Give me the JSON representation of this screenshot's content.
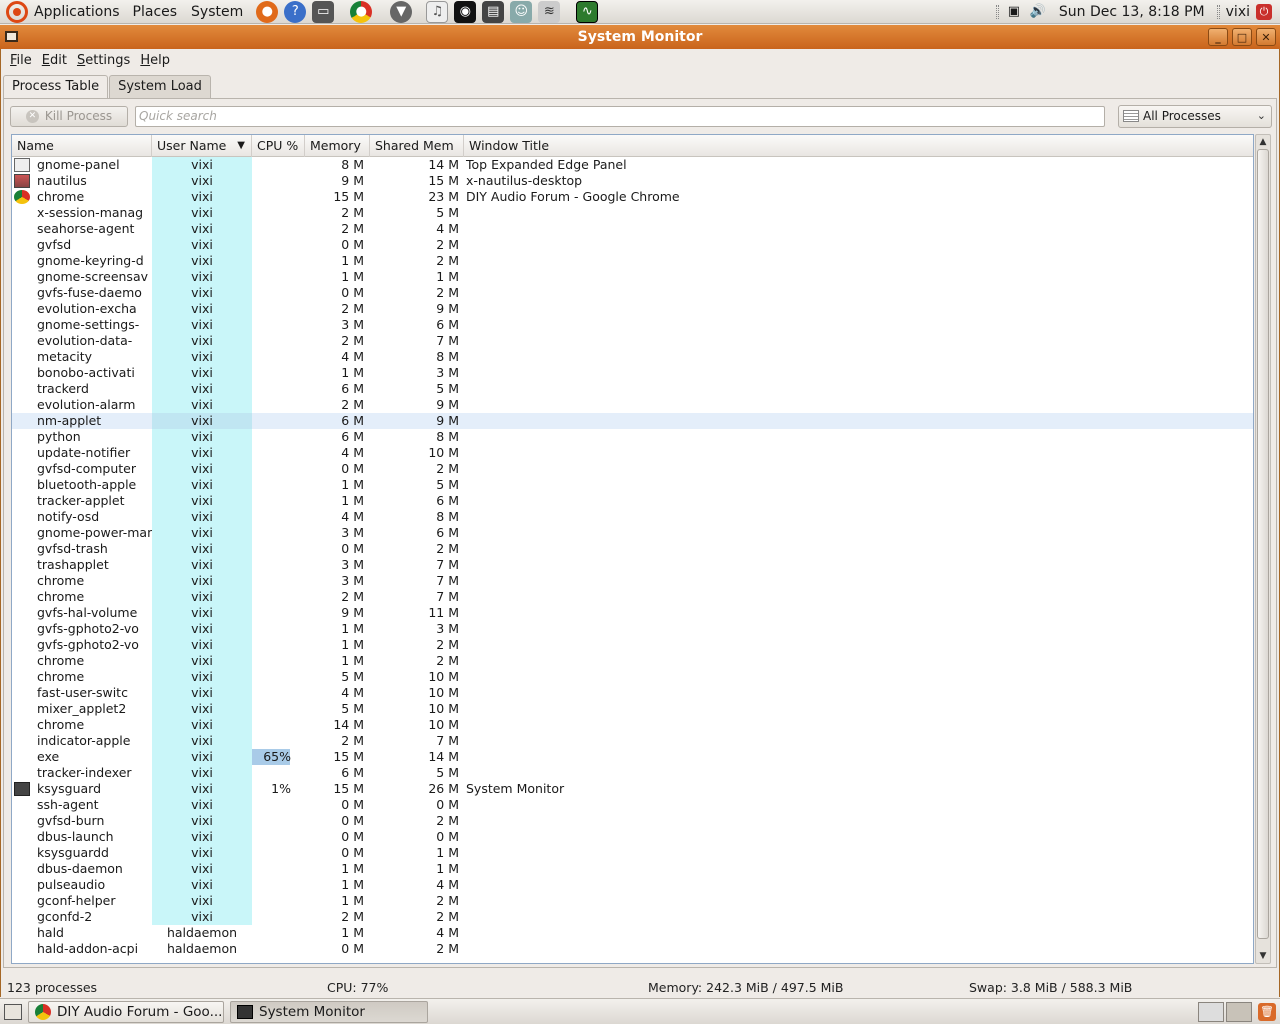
{
  "top_panel": {
    "menus": [
      "Applications",
      "Places",
      "System"
    ],
    "clock": "Sun Dec 13,  8:18 PM",
    "user": "vixi"
  },
  "window": {
    "title": "System Monitor",
    "menus": [
      "File",
      "Edit",
      "Settings",
      "Help"
    ],
    "tabs": [
      "Process Table",
      "System Load"
    ]
  },
  "toolbar": {
    "kill_label": "Kill Process",
    "search_placeholder": "Quick search",
    "filter_value": "All Processes"
  },
  "table": {
    "columns": [
      "Name",
      "User Name",
      "CPU %",
      "Memory",
      "Shared Mem",
      "Window Title"
    ],
    "rows": [
      {
        "name": "gnome-panel",
        "user": "vixi",
        "cpu": "",
        "mem": "8 M",
        "shared": "14 M",
        "title": "Top Expanded Edge Panel",
        "icon": "panel-icon"
      },
      {
        "name": "nautilus",
        "user": "vixi",
        "cpu": "",
        "mem": "9 M",
        "shared": "15 M",
        "title": "x-nautilus-desktop",
        "icon": "desktop-icon"
      },
      {
        "name": "chrome",
        "user": "vixi",
        "cpu": "",
        "mem": "15 M",
        "shared": "23 M",
        "title": "DIY Audio Forum - Google Chrome",
        "icon": "chrome-icon"
      },
      {
        "name": "x-session-manag",
        "user": "vixi",
        "cpu": "",
        "mem": "2 M",
        "shared": "5 M",
        "title": ""
      },
      {
        "name": "seahorse-agent",
        "user": "vixi",
        "cpu": "",
        "mem": "2 M",
        "shared": "4 M",
        "title": ""
      },
      {
        "name": "gvfsd",
        "user": "vixi",
        "cpu": "",
        "mem": "0 M",
        "shared": "2 M",
        "title": ""
      },
      {
        "name": "gnome-keyring-d",
        "user": "vixi",
        "cpu": "",
        "mem": "1 M",
        "shared": "2 M",
        "title": ""
      },
      {
        "name": "gnome-screensav",
        "user": "vixi",
        "cpu": "",
        "mem": "1 M",
        "shared": "1 M",
        "title": ""
      },
      {
        "name": "gvfs-fuse-daemo",
        "user": "vixi",
        "cpu": "",
        "mem": "0 M",
        "shared": "2 M",
        "title": ""
      },
      {
        "name": "evolution-excha",
        "user": "vixi",
        "cpu": "",
        "mem": "2 M",
        "shared": "9 M",
        "title": ""
      },
      {
        "name": "gnome-settings-",
        "user": "vixi",
        "cpu": "",
        "mem": "3 M",
        "shared": "6 M",
        "title": ""
      },
      {
        "name": "evolution-data-",
        "user": "vixi",
        "cpu": "",
        "mem": "2 M",
        "shared": "7 M",
        "title": ""
      },
      {
        "name": "metacity",
        "user": "vixi",
        "cpu": "",
        "mem": "4 M",
        "shared": "8 M",
        "title": ""
      },
      {
        "name": "bonobo-activati",
        "user": "vixi",
        "cpu": "",
        "mem": "1 M",
        "shared": "3 M",
        "title": ""
      },
      {
        "name": "trackerd",
        "user": "vixi",
        "cpu": "",
        "mem": "6 M",
        "shared": "5 M",
        "title": ""
      },
      {
        "name": "evolution-alarm",
        "user": "vixi",
        "cpu": "",
        "mem": "2 M",
        "shared": "9 M",
        "title": ""
      },
      {
        "name": "nm-applet",
        "user": "vixi",
        "cpu": "",
        "mem": "6 M",
        "shared": "9 M",
        "title": "",
        "selected": true
      },
      {
        "name": "python",
        "user": "vixi",
        "cpu": "",
        "mem": "6 M",
        "shared": "8 M",
        "title": ""
      },
      {
        "name": "update-notifier",
        "user": "vixi",
        "cpu": "",
        "mem": "4 M",
        "shared": "10 M",
        "title": ""
      },
      {
        "name": "gvfsd-computer",
        "user": "vixi",
        "cpu": "",
        "mem": "0 M",
        "shared": "2 M",
        "title": ""
      },
      {
        "name": "bluetooth-apple",
        "user": "vixi",
        "cpu": "",
        "mem": "1 M",
        "shared": "5 M",
        "title": ""
      },
      {
        "name": "tracker-applet",
        "user": "vixi",
        "cpu": "",
        "mem": "1 M",
        "shared": "6 M",
        "title": ""
      },
      {
        "name": "notify-osd",
        "user": "vixi",
        "cpu": "",
        "mem": "4 M",
        "shared": "8 M",
        "title": ""
      },
      {
        "name": "gnome-power-man",
        "user": "vixi",
        "cpu": "",
        "mem": "3 M",
        "shared": "6 M",
        "title": ""
      },
      {
        "name": "gvfsd-trash",
        "user": "vixi",
        "cpu": "",
        "mem": "0 M",
        "shared": "2 M",
        "title": ""
      },
      {
        "name": "trashapplet",
        "user": "vixi",
        "cpu": "",
        "mem": "3 M",
        "shared": "7 M",
        "title": ""
      },
      {
        "name": "chrome",
        "user": "vixi",
        "cpu": "",
        "mem": "3 M",
        "shared": "7 M",
        "title": ""
      },
      {
        "name": "chrome",
        "user": "vixi",
        "cpu": "",
        "mem": "2 M",
        "shared": "7 M",
        "title": ""
      },
      {
        "name": "gvfs-hal-volume",
        "user": "vixi",
        "cpu": "",
        "mem": "9 M",
        "shared": "11 M",
        "title": ""
      },
      {
        "name": "gvfs-gphoto2-vo",
        "user": "vixi",
        "cpu": "",
        "mem": "1 M",
        "shared": "3 M",
        "title": ""
      },
      {
        "name": "gvfs-gphoto2-vo",
        "user": "vixi",
        "cpu": "",
        "mem": "1 M",
        "shared": "2 M",
        "title": ""
      },
      {
        "name": "chrome",
        "user": "vixi",
        "cpu": "",
        "mem": "1 M",
        "shared": "2 M",
        "title": ""
      },
      {
        "name": "chrome",
        "user": "vixi",
        "cpu": "",
        "mem": "5 M",
        "shared": "10 M",
        "title": ""
      },
      {
        "name": "fast-user-switc",
        "user": "vixi",
        "cpu": "",
        "mem": "4 M",
        "shared": "10 M",
        "title": ""
      },
      {
        "name": "mixer_applet2",
        "user": "vixi",
        "cpu": "",
        "mem": "5 M",
        "shared": "10 M",
        "title": ""
      },
      {
        "name": "chrome",
        "user": "vixi",
        "cpu": "",
        "mem": "14 M",
        "shared": "10 M",
        "title": ""
      },
      {
        "name": "indicator-apple",
        "user": "vixi",
        "cpu": "",
        "mem": "2 M",
        "shared": "7 M",
        "title": ""
      },
      {
        "name": "exe",
        "user": "vixi",
        "cpu": "65%",
        "cpu_fraction": 0.65,
        "mem": "15 M",
        "shared": "14 M",
        "title": ""
      },
      {
        "name": "tracker-indexer",
        "user": "vixi",
        "cpu": "",
        "mem": "6 M",
        "shared": "5 M",
        "title": ""
      },
      {
        "name": "ksysguard",
        "user": "vixi",
        "cpu": "1%",
        "mem": "15 M",
        "shared": "26 M",
        "title": "System Monitor",
        "icon": "monitor-icon"
      },
      {
        "name": "ssh-agent",
        "user": "vixi",
        "cpu": "",
        "mem": "0 M",
        "shared": "0 M",
        "title": ""
      },
      {
        "name": "gvfsd-burn",
        "user": "vixi",
        "cpu": "",
        "mem": "0 M",
        "shared": "2 M",
        "title": ""
      },
      {
        "name": "dbus-launch",
        "user": "vixi",
        "cpu": "",
        "mem": "0 M",
        "shared": "0 M",
        "title": ""
      },
      {
        "name": "ksysguardd",
        "user": "vixi",
        "cpu": "",
        "mem": "0 M",
        "shared": "1 M",
        "title": ""
      },
      {
        "name": "dbus-daemon",
        "user": "vixi",
        "cpu": "",
        "mem": "1 M",
        "shared": "1 M",
        "title": ""
      },
      {
        "name": "pulseaudio",
        "user": "vixi",
        "cpu": "",
        "mem": "1 M",
        "shared": "4 M",
        "title": ""
      },
      {
        "name": "gconf-helper",
        "user": "vixi",
        "cpu": "",
        "mem": "1 M",
        "shared": "2 M",
        "title": ""
      },
      {
        "name": "gconfd-2",
        "user": "vixi",
        "cpu": "",
        "mem": "2 M",
        "shared": "2 M",
        "title": ""
      },
      {
        "name": "hald",
        "user": "haldaemon",
        "cpu": "",
        "mem": "1 M",
        "shared": "4 M",
        "title": ""
      },
      {
        "name": "hald-addon-acpi",
        "user": "haldaemon",
        "cpu": "",
        "mem": "0 M",
        "shared": "2 M",
        "title": ""
      }
    ]
  },
  "status": {
    "processes": "123 processes",
    "cpu": "CPU: 77%",
    "memory": "Memory: 242.3 MiB / 497.5 MiB",
    "swap": "Swap: 3.8 MiB / 588.3 MiB"
  },
  "taskbar": {
    "tasks": [
      "DIY Audio Forum - Goo...",
      "System Monitor"
    ]
  }
}
